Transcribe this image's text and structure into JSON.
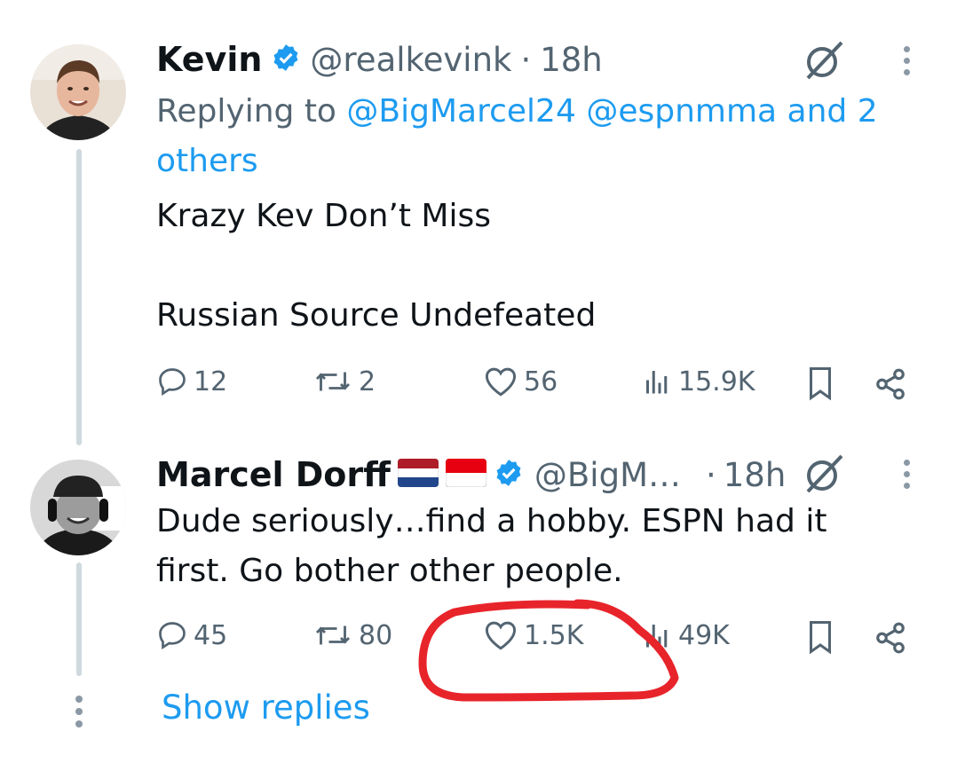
{
  "tweet1": {
    "author": "Kevin",
    "handle": "@realkevink",
    "separator": "·",
    "time": "18h",
    "replying_label": "Replying to",
    "mention1": "@BigMarcel24",
    "mention2": "@espnmma",
    "and_others": "and 2 others",
    "line1": "Krazy Kev Don’t Miss",
    "line2": "Russian Source Undefeated",
    "stats": {
      "replies": "12",
      "reposts": "2",
      "likes": "56",
      "views": "15.9K"
    }
  },
  "tweet2": {
    "author": "Marcel Dorff",
    "flags": [
      "netherlands-flag",
      "indonesia-flag"
    ],
    "handle": "@BigM…",
    "separator": "·",
    "time": "18h",
    "text": "Dude seriously…find a hobby. ESPN had it first. Go bother other people.",
    "stats": {
      "replies": "45",
      "reposts": "80",
      "likes": "1.5K",
      "views": "49K"
    }
  },
  "show_replies": "Show replies",
  "colors": {
    "accent": "#1d9bf0",
    "muted": "#536471",
    "annotation": "#e8242b"
  },
  "icons": [
    "verified-badge-icon",
    "grok-icon",
    "more-dots-icon",
    "reply-icon",
    "repost-icon",
    "like-icon",
    "views-icon",
    "bookmark-icon",
    "share-icon"
  ]
}
